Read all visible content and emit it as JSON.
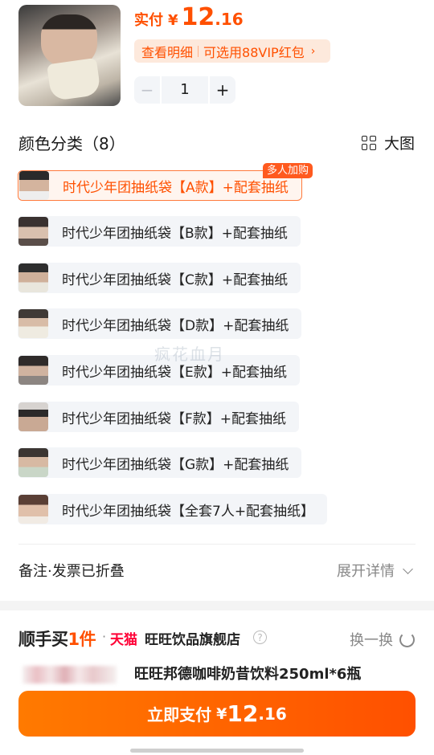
{
  "header": {
    "price_label": "实付",
    "currency": "¥",
    "price_int": "12",
    "price_dec": ".16",
    "detail_link": "查看明细",
    "vip_link": "可选用88VIP红包",
    "chevron": "›"
  },
  "quantity": {
    "minus": "−",
    "value": "1",
    "plus": "+"
  },
  "variants": {
    "title": "颜色分类（8）",
    "big_image_label": "大图",
    "multi_badge": "多人加购",
    "items": [
      {
        "label": "时代少年团抽纸袋【A款】+配套抽纸"
      },
      {
        "label": "时代少年团抽纸袋【B款】+配套抽纸"
      },
      {
        "label": "时代少年团抽纸袋【C款】+配套抽纸"
      },
      {
        "label": "时代少年团抽纸袋【D款】+配套抽纸"
      },
      {
        "label": "时代少年团抽纸袋【E款】+配套抽纸"
      },
      {
        "label": "时代少年团抽纸袋【F款】+配套抽纸"
      },
      {
        "label": "时代少年团抽纸袋【G款】+配套抽纸"
      },
      {
        "label": "时代少年团抽纸袋【全套7人+配套抽纸】"
      }
    ]
  },
  "watermark": "疯花血月",
  "remarks": {
    "label": "备注·发票已折叠",
    "expand": "展开详情"
  },
  "recommend": {
    "title_a": "顺手买",
    "title_num": "1件",
    "dot": "·",
    "tmall": "天猫",
    "store": "旺旺饮品旗舰店",
    "help": "?",
    "swap": "换一换",
    "product_name": "旺旺邦德咖啡奶昔饮料250ml*6瓶"
  },
  "pay": {
    "label": "立即支付",
    "currency": "¥",
    "int": "12",
    "dec": ".16"
  },
  "colors": {
    "accent": "#ff5000",
    "tmall": "#ff0036"
  }
}
